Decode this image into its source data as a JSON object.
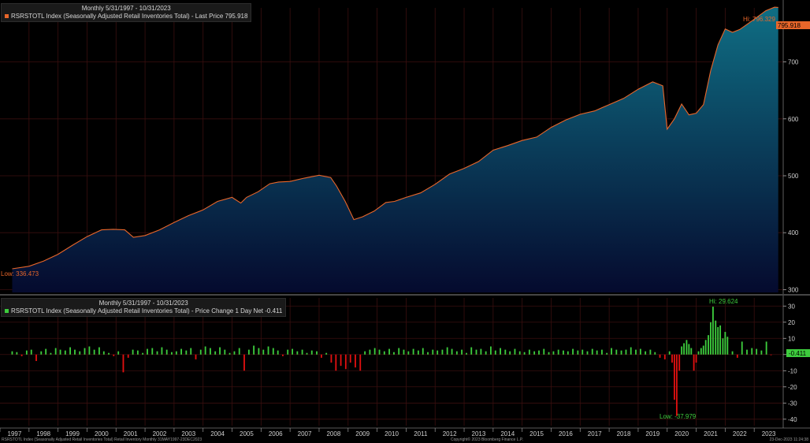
{
  "top_panel": {
    "period": "Monthly 5/31/1997 - 10/31/2023",
    "legend": "RSRSTOTL Index (Seasonally Adjusted Retail Inventories Total) - Last Price 795.918",
    "hi_label": "Hi: 796.329",
    "low_label": "Low: 336.473",
    "last_price_tag": "795.918"
  },
  "bottom_panel": {
    "period": "Monthly 5/31/1997 - 10/31/2023",
    "legend": "RSRSTOTL Index (Seasonally Adjusted Retail Inventories Total) - Price Change 1 Day Net -0.411",
    "hi_label": "Hi: 29.624",
    "low_label": "Low: -37.979",
    "last_change_tag": "-0.411"
  },
  "footer": {
    "left": "RSRSTOTL Index (Seasonally Adjusted Retail Inventories Total) Retail Inventory  Monthly 31MAY1997-23DEC2023",
    "center": "Copyright© 2023 Bloomberg Finance L.P.",
    "right": "23-Dec-2023 11:24:38"
  },
  "colors": {
    "line": "#e8662a",
    "area_top": "#0f6e84",
    "area_bottom": "#050a2e",
    "bar_up": "#3dcc3d",
    "bar_down": "#e01010",
    "grid": "#3a0f0f",
    "separator": "#a0a0a0"
  },
  "chart_data": [
    {
      "type": "area",
      "title": "RSRSTOTL Index (Seasonally Adjusted Retail Inventories Total) - Last Price 795.918",
      "x_range": [
        "1997-05-31",
        "2023-10-31"
      ],
      "ylim": [
        295,
        795
      ],
      "yticks": [
        300,
        400,
        500,
        600,
        700
      ],
      "grid": true,
      "x": [
        1997.42,
        1998.0,
        1998.5,
        1999.0,
        1999.5,
        2000.0,
        2000.5,
        2000.9,
        2001.3,
        2001.6,
        2002.0,
        2002.5,
        2003.0,
        2003.5,
        2004.0,
        2004.5,
        2005.0,
        2005.3,
        2005.5,
        2005.9,
        2006.3,
        2006.6,
        2007.0,
        2007.5,
        2008.0,
        2008.4,
        2008.6,
        2008.9,
        2009.2,
        2009.5,
        2009.9,
        2010.3,
        2010.6,
        2011.0,
        2011.5,
        2012.0,
        2012.5,
        2013.0,
        2013.5,
        2014.0,
        2014.5,
        2015.0,
        2015.5,
        2016.0,
        2016.5,
        2017.0,
        2017.5,
        2018.0,
        2018.5,
        2019.0,
        2019.5,
        2019.85,
        2020.0,
        2020.25,
        2020.5,
        2020.75,
        2021.0,
        2021.25,
        2021.5,
        2021.75,
        2022.0,
        2022.25,
        2022.5,
        2022.75,
        2023.0,
        2023.4,
        2023.7,
        2023.83
      ],
      "values": [
        336.5,
        341,
        350,
        362,
        378,
        393,
        405,
        406,
        405,
        392,
        395,
        405,
        418,
        430,
        440,
        455,
        462,
        452,
        462,
        472,
        486,
        489,
        490,
        496,
        501,
        497,
        482,
        455,
        423,
        428,
        438,
        453,
        455,
        462,
        470,
        485,
        503,
        513,
        525,
        545,
        553,
        562,
        568,
        585,
        598,
        608,
        614,
        625,
        636,
        652,
        665,
        658,
        582,
        600,
        626,
        607,
        610,
        625,
        685,
        730,
        758,
        752,
        757,
        766,
        775,
        790,
        796.3,
        795.9
      ]
    },
    {
      "type": "bar",
      "title": "RSRSTOTL Index (Seasonally Adjusted Retail Inventories Total) - Price Change 1 Day Net -0.411",
      "x_range": [
        "1997-05-31",
        "2023-10-31"
      ],
      "ylim": [
        -44,
        35
      ],
      "yticks": [
        30,
        20,
        10,
        0,
        -10,
        -20,
        -30,
        -40
      ],
      "grid": true,
      "x": [
        1997.42,
        1997.58,
        1997.75,
        1997.92,
        1998.08,
        1998.25,
        1998.42,
        1998.58,
        1998.75,
        1998.92,
        1999.08,
        1999.25,
        1999.42,
        1999.58,
        1999.75,
        1999.92,
        2000.08,
        2000.25,
        2000.42,
        2000.58,
        2000.75,
        2000.92,
        2001.08,
        2001.25,
        2001.42,
        2001.58,
        2001.75,
        2001.92,
        2002.08,
        2002.25,
        2002.42,
        2002.58,
        2002.75,
        2002.92,
        2003.08,
        2003.25,
        2003.42,
        2003.58,
        2003.75,
        2003.92,
        2004.08,
        2004.25,
        2004.42,
        2004.58,
        2004.75,
        2004.92,
        2005.08,
        2005.25,
        2005.42,
        2005.58,
        2005.75,
        2005.92,
        2006.08,
        2006.25,
        2006.42,
        2006.58,
        2006.75,
        2006.92,
        2007.08,
        2007.25,
        2007.42,
        2007.58,
        2007.75,
        2007.92,
        2008.08,
        2008.25,
        2008.42,
        2008.58,
        2008.75,
        2008.92,
        2009.08,
        2009.25,
        2009.42,
        2009.58,
        2009.75,
        2009.92,
        2010.08,
        2010.25,
        2010.42,
        2010.58,
        2010.75,
        2010.92,
        2011.08,
        2011.25,
        2011.42,
        2011.58,
        2011.75,
        2011.92,
        2012.08,
        2012.25,
        2012.42,
        2012.58,
        2012.75,
        2012.92,
        2013.08,
        2013.25,
        2013.42,
        2013.58,
        2013.75,
        2013.92,
        2014.08,
        2014.25,
        2014.42,
        2014.58,
        2014.75,
        2014.92,
        2015.08,
        2015.25,
        2015.42,
        2015.58,
        2015.75,
        2015.92,
        2016.08,
        2016.25,
        2016.42,
        2016.58,
        2016.75,
        2016.92,
        2017.08,
        2017.25,
        2017.42,
        2017.58,
        2017.75,
        2017.92,
        2018.08,
        2018.25,
        2018.42,
        2018.58,
        2018.75,
        2018.92,
        2019.08,
        2019.25,
        2019.42,
        2019.58,
        2019.75,
        2019.92,
        2020.08,
        2020.17,
        2020.25,
        2020.33,
        2020.42,
        2020.5,
        2020.58,
        2020.67,
        2020.75,
        2020.83,
        2020.92,
        2021.0,
        2021.08,
        2021.17,
        2021.25,
        2021.33,
        2021.42,
        2021.5,
        2021.58,
        2021.67,
        2021.75,
        2021.83,
        2021.92,
        2022.0,
        2022.08,
        2022.25,
        2022.42,
        2022.58,
        2022.75,
        2022.92,
        2023.08,
        2023.25,
        2023.42,
        2023.58,
        2023.75,
        2023.83
      ],
      "values": [
        2.0,
        1.5,
        -1.0,
        2.5,
        3.0,
        -4.0,
        2.0,
        3.5,
        1.0,
        4.0,
        3.0,
        2.5,
        4.5,
        3.0,
        2.0,
        4.0,
        5.0,
        3.0,
        4.5,
        2.0,
        1.0,
        -1.0,
        2.0,
        -11.0,
        -2.0,
        3.0,
        2.5,
        1.0,
        3.5,
        4.0,
        2.0,
        4.5,
        3.0,
        1.5,
        2.0,
        3.5,
        2.5,
        4.0,
        -3.0,
        3.0,
        5.0,
        4.0,
        2.0,
        4.5,
        3.0,
        1.0,
        2.0,
        4.0,
        -10.0,
        3.0,
        5.5,
        4.0,
        3.0,
        5.0,
        4.0,
        2.5,
        -1.0,
        3.0,
        3.5,
        2.0,
        3.0,
        1.0,
        2.5,
        2.0,
        -2.0,
        1.0,
        -5.0,
        -10.0,
        -7.0,
        -9.0,
        -5.0,
        -8.0,
        -10.0,
        2.0,
        3.0,
        4.0,
        3.0,
        2.0,
        3.5,
        1.5,
        4.0,
        3.0,
        2.0,
        3.5,
        2.5,
        4.0,
        1.5,
        3.0,
        2.5,
        3.0,
        4.5,
        3.5,
        2.0,
        3.0,
        1.0,
        4.5,
        3.0,
        3.5,
        2.0,
        5.0,
        2.5,
        4.0,
        3.0,
        2.0,
        3.5,
        2.0,
        1.5,
        3.0,
        2.0,
        2.5,
        3.5,
        1.5,
        2.0,
        3.0,
        2.5,
        2.0,
        3.5,
        2.5,
        3.0,
        2.0,
        3.5,
        2.5,
        3.0,
        1.0,
        4.0,
        3.0,
        2.5,
        3.0,
        4.5,
        3.0,
        3.5,
        2.0,
        3.0,
        1.5,
        -2.0,
        -3.0,
        2.0,
        -5.0,
        -28.0,
        -38.0,
        -10.0,
        5.0,
        7.0,
        9.0,
        6.5,
        4.0,
        -10.0,
        -5.0,
        2.0,
        4.0,
        5.5,
        9.0,
        12.0,
        20.0,
        29.6,
        21.0,
        17.0,
        18.0,
        10.0,
        14.0,
        11.0,
        2.0,
        -2.0,
        8.0,
        3.0,
        4.0,
        3.5,
        2.5,
        8.0,
        -0.4
      ]
    }
  ]
}
